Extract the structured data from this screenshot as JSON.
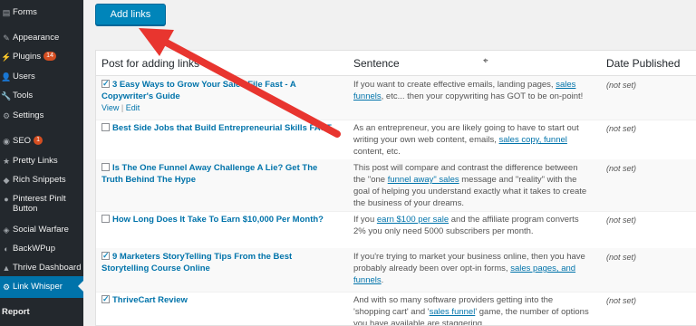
{
  "sidebar": {
    "items": [
      {
        "label": "Forms",
        "icon": "forms-icon",
        "glyph": "▤"
      },
      {
        "label": "Appearance",
        "icon": "appearance-icon",
        "glyph": "✎"
      },
      {
        "label": "Plugins",
        "icon": "plugins-icon",
        "glyph": "⚡",
        "badge": "14"
      },
      {
        "label": "Users",
        "icon": "users-icon",
        "glyph": "👤"
      },
      {
        "label": "Tools",
        "icon": "tools-icon",
        "glyph": "🔧"
      },
      {
        "label": "Settings",
        "icon": "settings-icon",
        "glyph": "⚙"
      },
      {
        "label": "SEO",
        "icon": "seo-icon",
        "glyph": "◉",
        "badge": "1"
      },
      {
        "label": "Pretty Links",
        "icon": "pretty-links-icon",
        "glyph": "★"
      },
      {
        "label": "Rich Snippets",
        "icon": "rich-snippets-icon",
        "glyph": "◆"
      },
      {
        "label": "Pinterest Pinlt Button",
        "icon": "pinterest-icon",
        "glyph": "●"
      },
      {
        "label": "Social Warfare",
        "icon": "social-warfare-icon",
        "glyph": "◈"
      },
      {
        "label": "BackWPup",
        "icon": "backwpup-icon",
        "glyph": "◐"
      },
      {
        "label": "Thrive Dashboard",
        "icon": "thrive-dashboard-icon",
        "glyph": "▲"
      },
      {
        "label": "Link Whisper",
        "icon": "link-whisper-icon",
        "glyph": "⚙",
        "active": true
      },
      {
        "label": "Report",
        "icon": "",
        "glyph": ""
      }
    ]
  },
  "toolbar": {
    "add_links_label": "Add links"
  },
  "table": {
    "headers": {
      "post": "Post for adding links",
      "sentence": "Sentence",
      "date": "Date Published"
    },
    "rows": [
      {
        "checked": true,
        "post": "3 Easy Ways to Grow Your Sales File Fast - A Copywriter's Guide",
        "actions": {
          "view": "View",
          "sep": "|",
          "edit": "Edit"
        },
        "sentence_parts": [
          {
            "text": "If you want to create effective emails, landing pages, "
          },
          {
            "text": "sales funnels",
            "link": true
          },
          {
            "text": ", etc... then your copywriting has GOT to be on-point!"
          }
        ],
        "date": "(not set)"
      },
      {
        "checked": false,
        "post": "Best Side Jobs that Build Entrepreneurial Skills FAST",
        "sentence_parts": [
          {
            "text": "As an entrepreneur, you are likely going to have to start out writing your own web content, emails, "
          },
          {
            "text": "sales copy, funnel",
            "link": true
          },
          {
            "text": " content, etc."
          }
        ],
        "date": "(not set)"
      },
      {
        "checked": false,
        "post": "Is The One Funnel Away Challenge A Lie? Get The Truth Behind The Hype",
        "sentence_parts": [
          {
            "text": "This post will compare and contrast the difference between the \"one "
          },
          {
            "text": "funnel away\" sales",
            "link": true
          },
          {
            "text": " message and \"reality\" with the goal of helping you understand exactly what it takes to create the business of your dreams."
          }
        ],
        "date": "(not set)"
      },
      {
        "checked": false,
        "post": "How Long Does It Take To Earn $10,000 Per Month?",
        "sentence_parts": [
          {
            "text": "If you "
          },
          {
            "text": "earn $100 per sale",
            "link": true
          },
          {
            "text": " and the affiliate program converts 2% you only need 5000 subscribers per month."
          }
        ],
        "date": "(not set)"
      },
      {
        "checked": true,
        "post": "9 Marketers StoryTelling Tips From the Best Storytelling Course Online",
        "sentence_parts": [
          {
            "text": "If you're trying to market your business online, then you have probably already been over opt-in forms, "
          },
          {
            "text": "sales pages, and funnels",
            "link": true
          },
          {
            "text": "."
          }
        ],
        "date": "(not set)"
      },
      {
        "checked": true,
        "post": "ThriveCart Review",
        "sentence_parts": [
          {
            "text": "And with so many software providers getting into the 'shopping cart' and '"
          },
          {
            "text": "sales funnel",
            "link": true
          },
          {
            "text": "' game, the number of options you have available are staggering."
          }
        ],
        "date": "(not set)"
      }
    ]
  },
  "colors": {
    "sidebar": "#23282d",
    "accent": "#0073aa",
    "button": "#0085ba",
    "arrow": "#e8352f"
  }
}
